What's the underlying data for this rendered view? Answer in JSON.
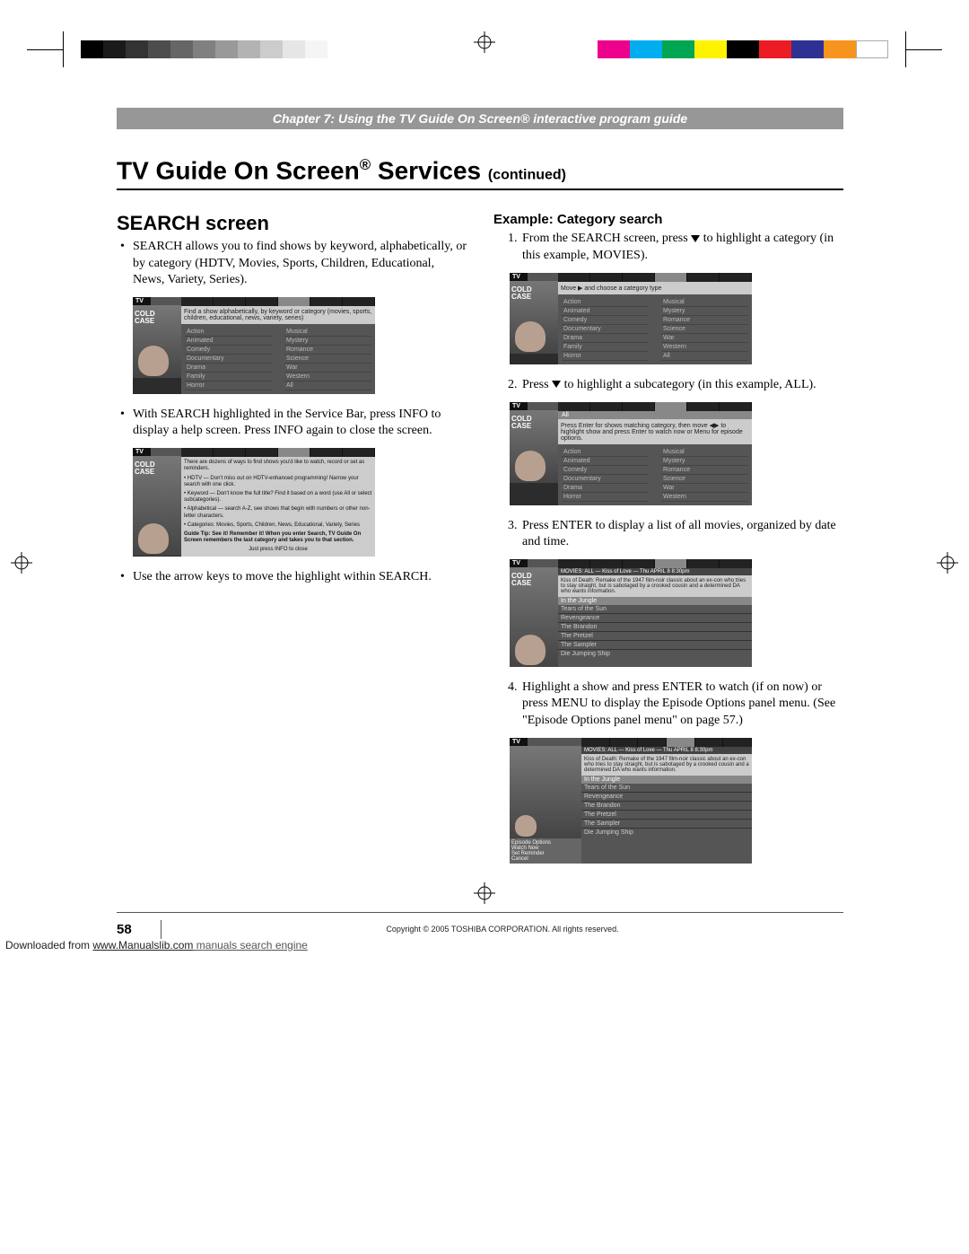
{
  "chapter_bar": "Chapter 7: Using the TV Guide On Screen® interactive program guide",
  "title_main_a": "TV Guide On Screen",
  "title_main_sup": "®",
  "title_main_b": " Services ",
  "title_main_cont": "(continued)",
  "section_search": "SEARCH screen",
  "left_bullets": {
    "b1": "SEARCH allows you to find shows by keyword, alphabetically, or by category (HDTV, Movies, Sports, Children, Educational, News, Variety, Series).",
    "b2": "With SEARCH highlighted in the Service Bar, press INFO to display a help screen. Press INFO again to close the screen.",
    "b3": "Use the arrow keys to move the highlight within SEARCH."
  },
  "example_heading": "Example: Category search",
  "steps": {
    "s1a": "From the SEARCH screen, press ",
    "s1b": " to highlight a category (in this example, MOVIES).",
    "s2a": "Press ",
    "s2b": " to highlight a subcategory (in this example, ALL).",
    "s3": "Press ENTER to display a list of all movies, organized by date and time.",
    "s4": "Highlight a show and press ENTER to watch (if on now) or press MENU to display the Episode Options panel menu. (See \"Episode Options panel menu\" on page 57.)"
  },
  "fig_categories_left": [
    "Action",
    "Animated",
    "Comedy",
    "Documentary",
    "Drama",
    "Family",
    "Horror"
  ],
  "fig_categories_right": [
    "Musical",
    "Mystery",
    "Romance",
    "Science",
    "War",
    "Western",
    "All"
  ],
  "fig1_msg": "Find a show alphabetically, by keyword or category (movies, sports, children, educational, news, variety, series)",
  "fig2_tips": [
    "There are dozens of ways to find shows you'd like to watch, record or set as reminders.",
    "• HDTV — Don't miss out on HDTV-enhanced programming! Narrow your search with one click.",
    "• Keyword — Don't know the full title? Find it based on a word (use All or select subcategories).",
    "• Alphabetical — search A-Z, see shows that begin with numbers or other non-letter characters.",
    "• Categories: Movies, Sports, Children, News, Educational, Variety, Series",
    "Guide Tip: See it! Remember it! When you enter Search, TV Guide On Screen remembers the last category and takes you to that section.",
    "Just press INFO to close"
  ],
  "fig3_msg": "Move ▶ and choose a category type",
  "fig4_msg": "Press Enter for shows matching category, then move ◀▶ to highlight show and press Enter to watch now or Menu for episode options.",
  "fig5_header": "MOVIES: ALL — Kiss of Love — Thu APRIL 8 8:30pm",
  "fig5_desc": "Kiss of Death: Remake of the 1947 film-noir classic about an ex-con who tries to stay straight, but is sabotaged by a crooked cousin and a determined DA who wants information.",
  "fig5_list": [
    "In the Jungle",
    "Tears of the Sun",
    "Revengeance",
    "The Brandon",
    "The Pretzel",
    "The Sampler",
    "Die Jumping Ship"
  ],
  "footer": {
    "page": "58",
    "copyright": "Copyright © 2005 TOSHIBA CORPORATION. All rights reserved."
  },
  "download": {
    "pre": "Downloaded from ",
    "link": "www.Manualslib.com",
    "post": " manuals search engine"
  },
  "poster_title": "COLD\nCASE"
}
